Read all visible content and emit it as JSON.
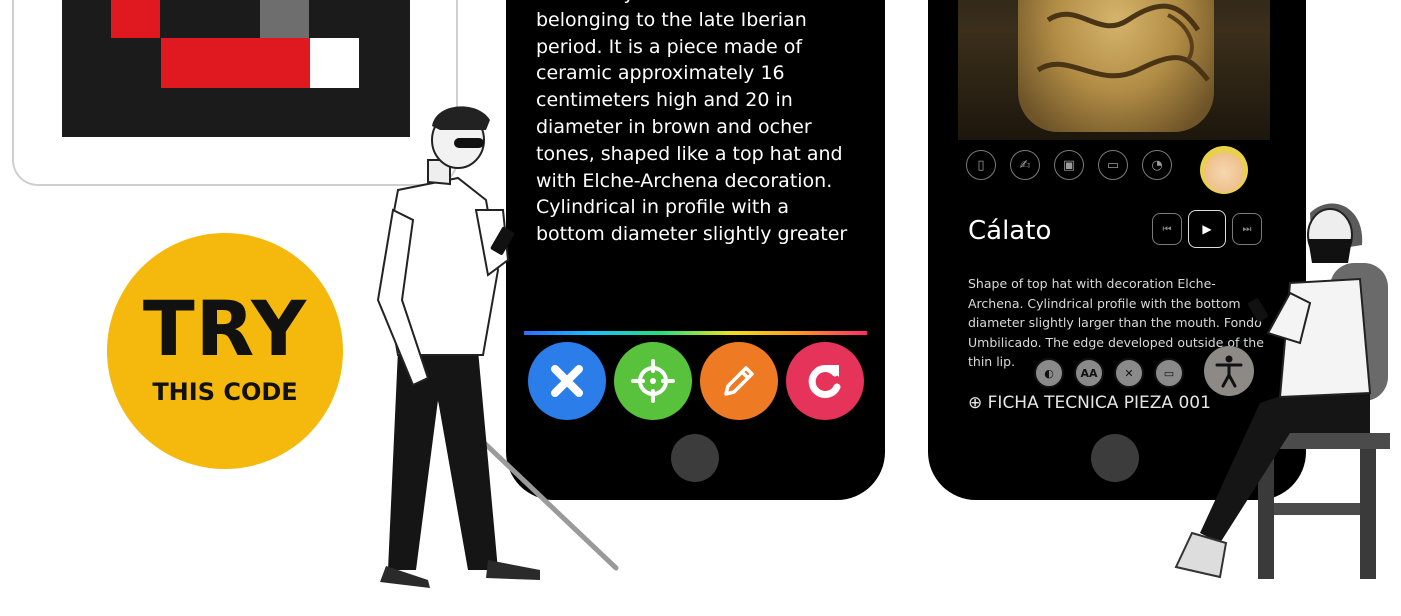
{
  "badge": {
    "line1": "TRY",
    "line2": "THIS CODE"
  },
  "phone1": {
    "description": "a funerary container and belonging to the late Iberian period. It is a piece made of ceramic approximately 16 centimeters high and 20 in diameter in brown and ocher tones, shaped like a top hat and with Elche-Archena decoration. Cylindrical in profile with a bottom diameter slightly greater",
    "buttons": [
      {
        "name": "close",
        "icon": "close-icon",
        "color": "#2b7de9"
      },
      {
        "name": "target",
        "icon": "crosshair-icon",
        "color": "#58c23c"
      },
      {
        "name": "edit",
        "icon": "pencil-icon",
        "color": "#ee7a23"
      },
      {
        "name": "reload",
        "icon": "refresh-icon",
        "color": "#e5335a"
      }
    ]
  },
  "phone2": {
    "title": "Cálato",
    "description": "Shape of top hat with decoration Elche-Archena. Cylindrical profile with the bottom diameter slightly larger than the mouth. Fondo Umbilicado. The edge developed outside of the thin lip.",
    "link": "⊕ FICHA TECNICA PIEZA 001",
    "media_icons": [
      "document-icon",
      "sign-language-icon",
      "image-icon",
      "video-icon",
      "audio-360-icon"
    ],
    "controls": {
      "prev": "⏮",
      "play": "▶",
      "next": "⏭"
    },
    "a11y_icons": {
      "contrast": "◐",
      "text_size": "AA",
      "hearing": "✕",
      "reading": "▭"
    }
  },
  "colors": {
    "badge": "#f4b90c",
    "qr_red": "#e01920",
    "qr_dark": "#1b1b1b"
  }
}
